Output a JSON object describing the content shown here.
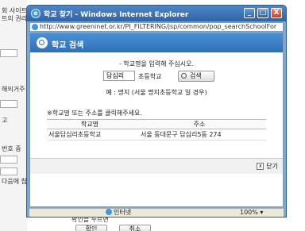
{
  "background": {
    "left_texts": [
      "회 사이트",
      "트의 권리",
      "해외거주",
      "번호 중",
      "다음에 참"
    ],
    "radio_label": "고",
    "bottom_hint": "확인을 누르면",
    "bottom_buttons": [
      "확인",
      "취소"
    ]
  },
  "window": {
    "title": "학교 찾기 - Windows Internet Explorer",
    "url": "http://www.greeninet.or.kr/PI_FILTERING/jsp/common/pop_searchSchoolFor",
    "controls": {
      "minimize": "_",
      "maximize": "□",
      "close": "X"
    }
  },
  "header": {
    "title": "학교 검색"
  },
  "search": {
    "instruction": "- 학교명을 입력해 주십시오.",
    "value": "답십리",
    "suffix": "초등학교",
    "button_label": "검색",
    "example": "예 : 명지 (서울 명지초등학교 일 경우)"
  },
  "results": {
    "note": "※학교명 또는 주소를 클릭해주세요.",
    "columns": [
      "학교명",
      "주소"
    ],
    "rows": [
      {
        "name": "서울답십리초등학교",
        "address": "서울 동대문구 답십리5동 274"
      }
    ]
  },
  "footer": {
    "close_label": "닫기"
  },
  "status": {
    "zone": "인터넷",
    "zoom": "100%"
  },
  "colors": {
    "title_bar": "#2f64a8",
    "header": "#3a80c6"
  }
}
